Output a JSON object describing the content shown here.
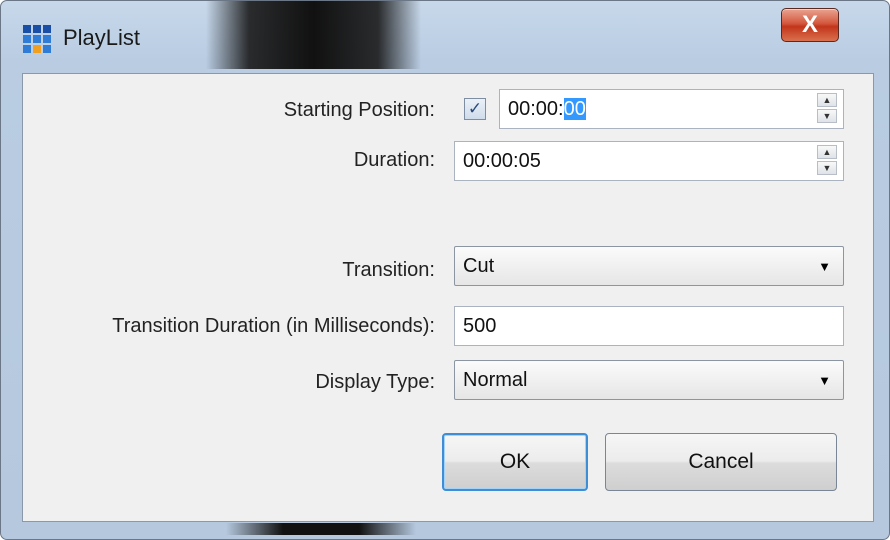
{
  "window": {
    "title": "PlayList",
    "close_symbol": "X",
    "icon": "app-grid-icon",
    "icon_colors": [
      "#1a4fa8",
      "#1a4fa8",
      "#1a4fa8",
      "#2e7cd6",
      "#2e7cd6",
      "#2e7cd6",
      "#2e7cd6",
      "#f0a020",
      "#2e7cd6"
    ]
  },
  "form": {
    "starting_position": {
      "label": "Starting Position:",
      "checked": true,
      "check_glyph": "✓",
      "value_prefix": "00:00:",
      "value_selected": "00"
    },
    "duration": {
      "label": "Duration:",
      "value": "00:00:05"
    },
    "transition": {
      "label": "Transition:",
      "value": "Cut"
    },
    "transition_duration": {
      "label": "Transition Duration (in Milliseconds):",
      "value": "500"
    },
    "display_type": {
      "label": "Display Type:",
      "value": "Normal"
    }
  },
  "buttons": {
    "ok": "OK",
    "cancel": "Cancel"
  },
  "spinner": {
    "up": "▲",
    "down": "▼"
  },
  "dropdown_caret": "▼"
}
